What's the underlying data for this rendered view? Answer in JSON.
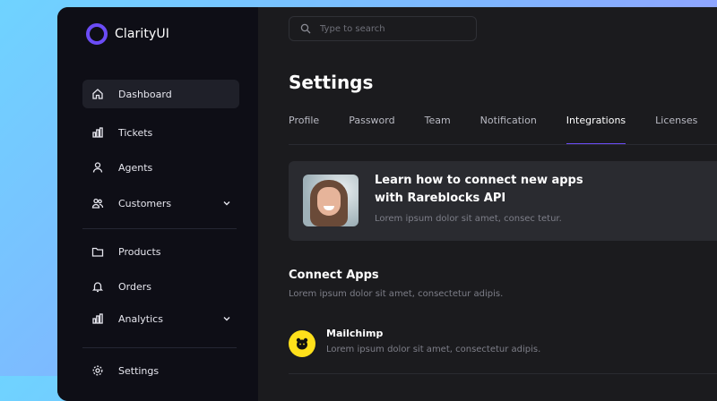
{
  "brand": {
    "name": "ClarityUI"
  },
  "sidebar": {
    "items": [
      {
        "label": "Dashboard",
        "icon": "home-icon"
      },
      {
        "label": "Tickets",
        "icon": "bar-chart-icon"
      },
      {
        "label": "Agents",
        "icon": "user-icon"
      },
      {
        "label": "Customers",
        "icon": "users-icon"
      },
      {
        "label": "Products",
        "icon": "folder-icon"
      },
      {
        "label": "Orders",
        "icon": "bell-icon"
      },
      {
        "label": "Analytics",
        "icon": "bar-chart-icon"
      },
      {
        "label": "Settings",
        "icon": "gear-icon"
      }
    ]
  },
  "search": {
    "placeholder": "Type to search"
  },
  "page": {
    "title": "Settings"
  },
  "tabs": [
    "Profile",
    "Password",
    "Team",
    "Notification",
    "Integrations",
    "Licenses"
  ],
  "banner": {
    "title": "Learn how to connect new apps with Rareblocks API",
    "subtitle": "Lorem ipsum dolor sit amet, consec tetur."
  },
  "connect": {
    "title": "Connect Apps",
    "subtitle": "Lorem ipsum dolor sit amet, consectetur adipis."
  },
  "apps": [
    {
      "name": "Mailchimp",
      "description": "Lorem ipsum dolor sit amet, consectetur adipis.",
      "icon": "mailchimp-icon"
    }
  ],
  "colors": {
    "accent": "#6b4cf6",
    "sidebar_bg": "#0e0e16",
    "main_bg": "#1b1b1e",
    "mailchimp": "#ffe01b"
  }
}
